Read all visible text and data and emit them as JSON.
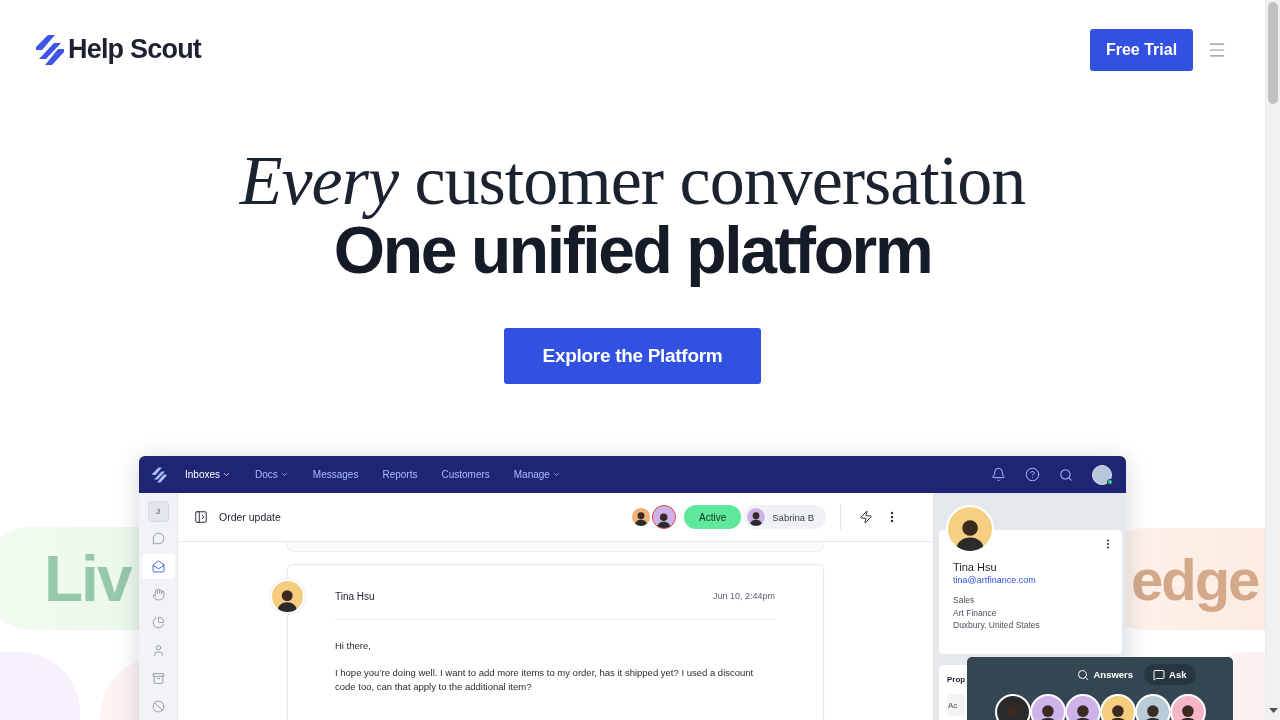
{
  "header": {
    "logo": "Help Scout",
    "cta": "Free Trial"
  },
  "hero": {
    "headline": "*Every* customer conversation",
    "subheadline": "One unified platform",
    "button": "Explore the Platform"
  },
  "feature_pills": [
    {
      "label": "Liv"
    },
    {
      "label": "edge"
    }
  ],
  "app": {
    "nav": [
      {
        "label": "Inboxes",
        "dropdown": true,
        "selected": true
      },
      {
        "label": "Docs",
        "dropdown": true,
        "selected": false
      },
      {
        "label": "Messages",
        "dropdown": false,
        "selected": false
      },
      {
        "label": "Reports",
        "dropdown": false,
        "selected": false
      },
      {
        "label": "Customers",
        "dropdown": false,
        "selected": false
      },
      {
        "label": "Manage",
        "dropdown": true,
        "selected": false
      }
    ],
    "rail": {
      "initial": "J",
      "items": [
        {
          "selected": false
        },
        {
          "selected": true
        },
        {
          "selected": false
        },
        {
          "selected": false
        },
        {
          "selected": false
        },
        {
          "selected": false
        },
        {
          "selected": false
        }
      ]
    },
    "conversation": {
      "subject": "Order update",
      "status": "Active",
      "assignee": "Sabrina B",
      "message": {
        "sender": "Tina Hsu",
        "time": "Jun 10, 2:44pm",
        "greeting": "Hi there,",
        "body": "I hope you’re doing well. I want to add more items to my order, has it shipped yet? I used a discount code too, can that apply to the additional item?"
      }
    },
    "customer": {
      "name": "Tina Hsu",
      "email": "tina@artfinance.com",
      "details": [
        "Sales",
        "Art Finance",
        "Duxbury, United States"
      ]
    },
    "properties": {
      "title": "Prop",
      "field": "Ac"
    },
    "assistant": {
      "tabs": [
        {
          "label": "Answers",
          "selected": false
        },
        {
          "label": "Ask",
          "selected": true
        }
      ]
    }
  }
}
